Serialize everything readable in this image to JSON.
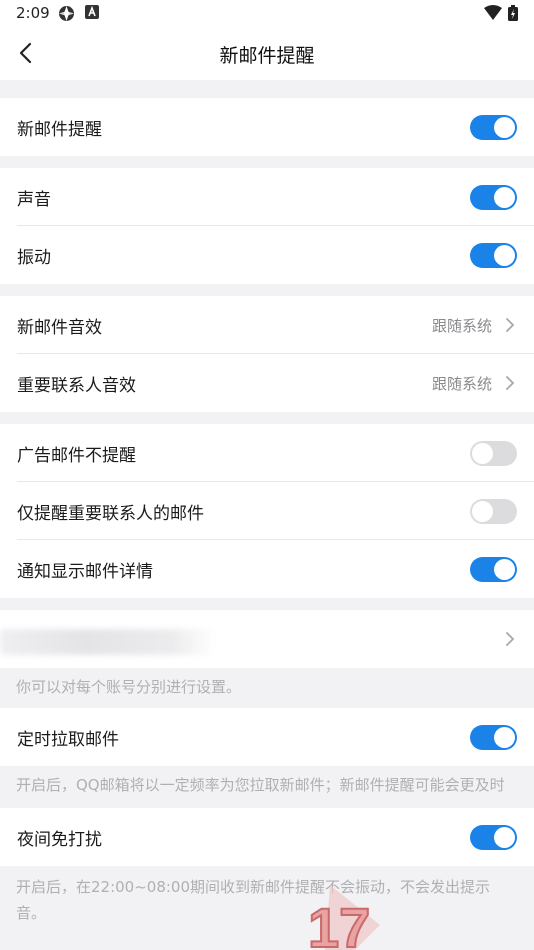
{
  "status_bar": {
    "time": "2:09"
  },
  "header": {
    "title": "新邮件提醒"
  },
  "sections": {
    "main": {
      "label": "新邮件提醒",
      "on": true
    },
    "sound": {
      "label": "声音",
      "on": true
    },
    "vibrate": {
      "label": "振动",
      "on": true
    },
    "new_mail_sound": {
      "label": "新邮件音效",
      "value": "跟随系统"
    },
    "vip_sound": {
      "label": "重要联系人音效",
      "value": "跟随系统"
    },
    "ad_no_remind": {
      "label": "广告邮件不提醒",
      "on": false
    },
    "vip_only": {
      "label": "仅提醒重要联系人的邮件",
      "on": false
    },
    "show_detail": {
      "label": "通知显示邮件详情",
      "on": true
    },
    "account_note": "你可以对每个账号分别进行设置。",
    "scheduled_fetch": {
      "label": "定时拉取邮件",
      "on": true
    },
    "scheduled_note": "开启后，QQ邮箱将以一定频率为您拉取新邮件；新邮件提醒可能会更及时",
    "night_mode": {
      "label": "夜间免打扰",
      "on": true
    },
    "night_note": "开启后，在22:00~08:00期间收到新邮件提醒不会振动，不会发出提示音。"
  },
  "watermark_text": "17",
  "colors": {
    "accent": "#1b82e8",
    "toggle_off": "#dcdcde",
    "background": "#f2f2f4"
  }
}
